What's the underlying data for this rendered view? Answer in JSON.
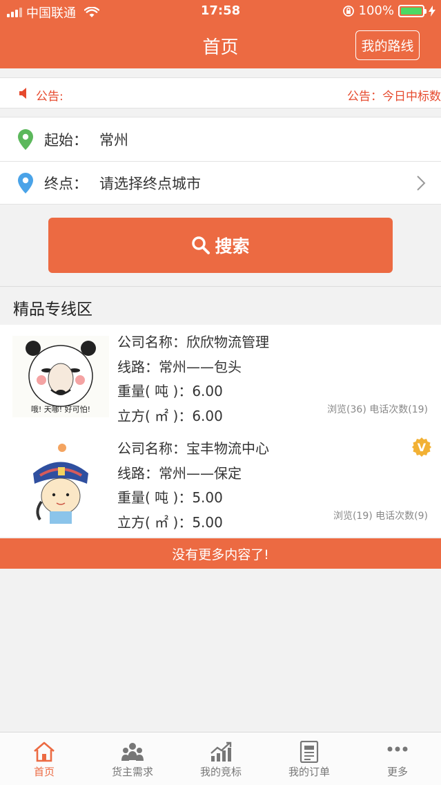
{
  "status_bar": {
    "carrier": "中国联通",
    "time": "17:58",
    "battery": "100%"
  },
  "header": {
    "title": "首页",
    "route_button": "我的路线"
  },
  "notice": {
    "label": "公告:",
    "marquee_text": "公告：今日中标数"
  },
  "location": {
    "start_label": "起始：",
    "start_value": "常州",
    "end_label": "终点：",
    "end_value": "请选择终点城市"
  },
  "search": {
    "label": "搜索"
  },
  "section": {
    "title": "精品专线区"
  },
  "listings": [
    {
      "company": "公司名称：欣欣物流管理",
      "route": "线路：常州——包头",
      "weight": "重量( 吨 )：6.00",
      "volume": "立方( ㎡ )：6.00",
      "stats": "浏览(36) 电话次数(19)",
      "thumb_caption": "哦! 天哪! 好可怕!"
    },
    {
      "company": "公司名称：宝丰物流中心",
      "route": "线路：常州——保定",
      "weight": "重量( 吨 )：5.00",
      "volume": "立方( ㎡ )：5.00",
      "stats": "浏览(19) 电话次数(9)",
      "badge": "V"
    }
  ],
  "footer_message": "没有更多内容了!",
  "tabbar": [
    {
      "label": "首页",
      "icon": "home-icon"
    },
    {
      "label": "货主需求",
      "icon": "users-icon"
    },
    {
      "label": "我的竞标",
      "icon": "chart-icon"
    },
    {
      "label": "我的订单",
      "icon": "document-icon"
    },
    {
      "label": "更多",
      "icon": "more-icon"
    }
  ],
  "colors": {
    "accent": "#ec6a42",
    "notice_text": "#e64a2e",
    "start_pin": "#5cb85c",
    "end_pin": "#4aa3e8"
  }
}
